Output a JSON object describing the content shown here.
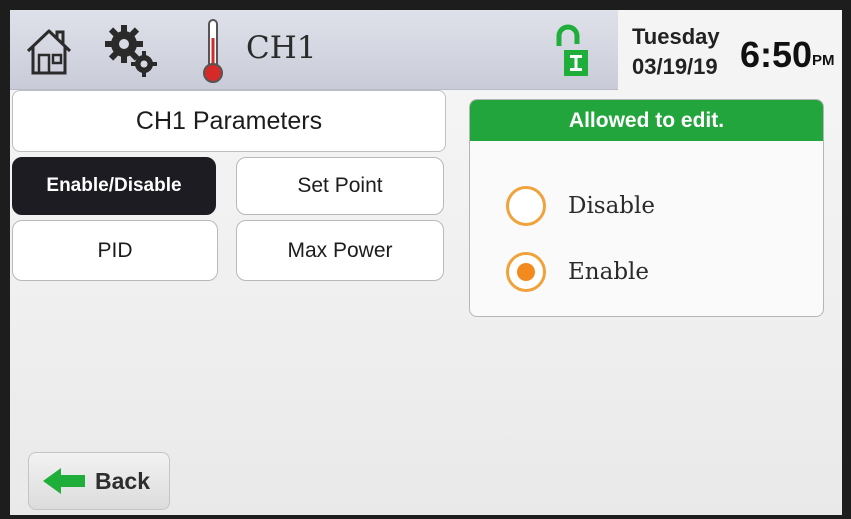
{
  "header": {
    "channel": "CH1",
    "icons": [
      "home-icon",
      "gear-icon",
      "thermometer-icon",
      "unlock-icon"
    ],
    "day": "Tuesday",
    "date": "03/19/19",
    "time": "6:50",
    "ampm": "PM"
  },
  "left": {
    "title": "CH1 Parameters",
    "buttons": {
      "enable_disable": "Enable/Disable",
      "set_point": "Set Point",
      "pid": "PID",
      "max_power": "Max Power"
    }
  },
  "right": {
    "header": "Allowed to edit.",
    "options": [
      {
        "label": "Disable",
        "selected": false
      },
      {
        "label": "Enable",
        "selected": true
      }
    ]
  },
  "footer": {
    "back_label": "Back"
  },
  "colors": {
    "accent_green": "#22a53c",
    "radio_orange": "#f28a1e",
    "active_button": "#1c1c22"
  }
}
